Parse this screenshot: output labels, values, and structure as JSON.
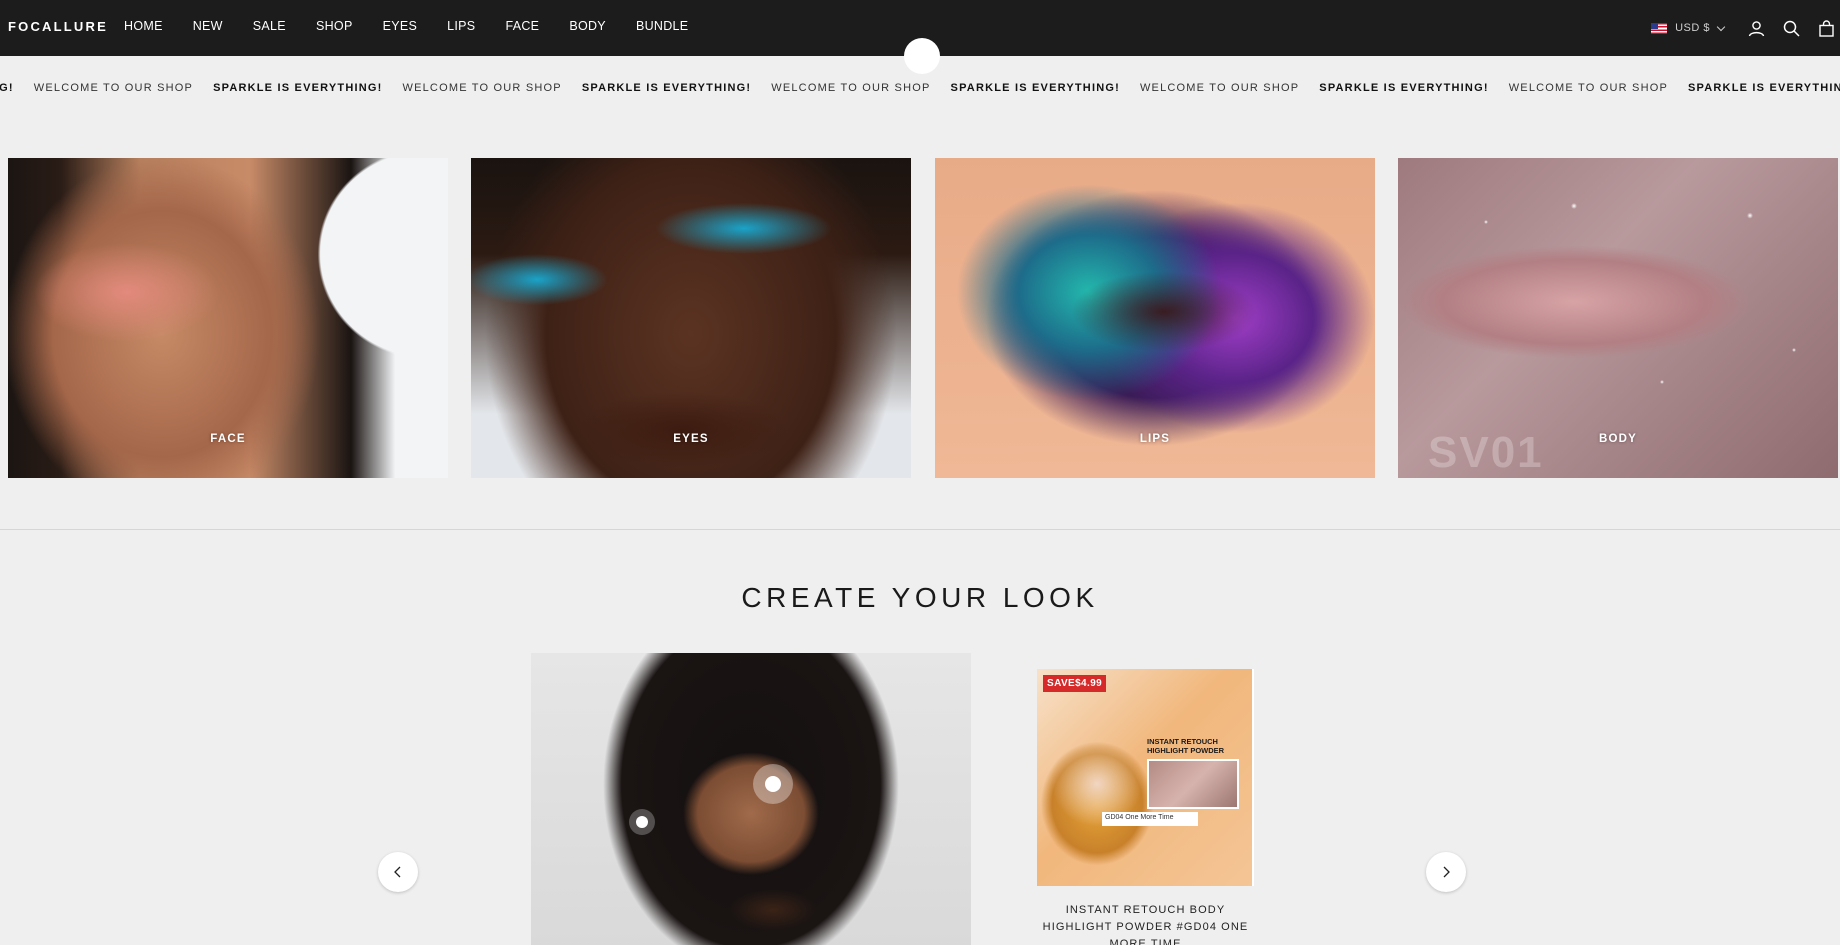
{
  "header": {
    "logo": "FOCALLURE",
    "nav": [
      "HOME",
      "NEW",
      "SALE",
      "SHOP",
      "EYES",
      "LIPS",
      "FACE",
      "BODY",
      "BUNDLE"
    ],
    "currency": "USD $",
    "icons": [
      "account-icon",
      "search-icon",
      "cart-icon"
    ]
  },
  "marquee": {
    "items": [
      {
        "text": "NG!",
        "bold": true
      },
      {
        "text": "WELCOME TO OUR SHOP",
        "bold": false
      },
      {
        "text": "SPARKLE IS EVERYTHING!",
        "bold": true
      },
      {
        "text": "WELCOME TO OUR SHOP",
        "bold": false
      },
      {
        "text": "SPARKLE IS EVERYTHING!",
        "bold": true
      },
      {
        "text": "WELCOME TO OUR SHOP",
        "bold": false
      },
      {
        "text": "SPARKLE IS EVERYTHING!",
        "bold": true
      },
      {
        "text": "WELCOME TO OUR SHOP",
        "bold": false
      },
      {
        "text": "SPARKLE IS EVERYTHING!",
        "bold": true
      },
      {
        "text": "WELCOME TO OUR SHOP",
        "bold": false
      },
      {
        "text": "SPARKLE IS EVERYTHING!",
        "bold": true
      }
    ]
  },
  "categories": [
    {
      "label": "FACE"
    },
    {
      "label": "EYES"
    },
    {
      "label": "LIPS"
    },
    {
      "label": "BODY"
    }
  ],
  "body_image_mark": "SV01",
  "section": {
    "title": "CREATE YOUR LOOK"
  },
  "product": {
    "badge": "SAVE$4.99",
    "image_title": "INSTANT RETOUCH HIGHLIGHT POWDER",
    "image_caption": "GD04 One More Time",
    "title": "INSTANT RETOUCH BODY HIGHLIGHT POWDER #GD04 ONE MORE TIME"
  },
  "colors": {
    "header_bg": "#1c1c1c",
    "page_bg": "#efefef",
    "badge_red": "#d62a2a"
  }
}
